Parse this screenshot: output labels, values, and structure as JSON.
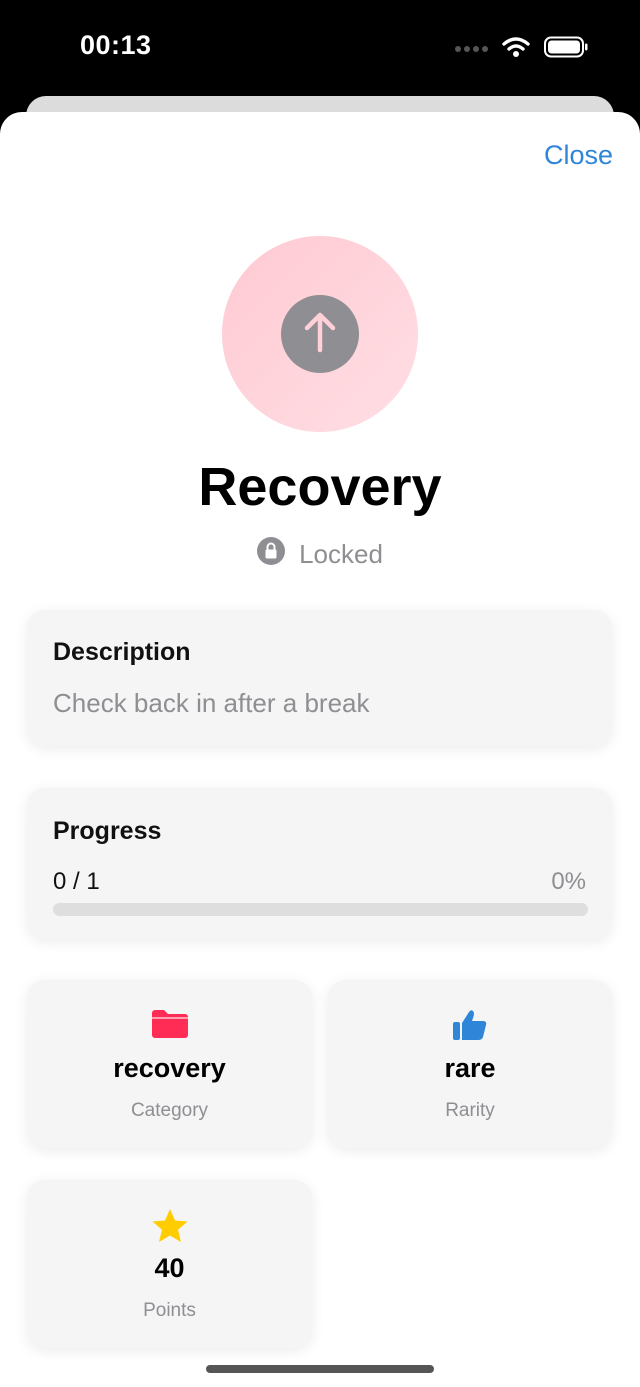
{
  "status_bar": {
    "time": "00:13"
  },
  "sheet": {
    "close_label": "Close",
    "achievement": {
      "title": "Recovery",
      "state": "Locked",
      "icon": "arrow-up-icon",
      "badge_colors": {
        "gradient_start": "#ffc9d2",
        "gradient_end": "#ffdfe4",
        "inner": "#8e8e93"
      }
    },
    "description": {
      "heading": "Description",
      "text": "Check back in after a break"
    },
    "progress": {
      "heading": "Progress",
      "count": "0 / 1",
      "percent_label": "0%",
      "value": 0
    },
    "stats": {
      "category": {
        "value": "recovery",
        "label": "Category",
        "icon": "folder-icon",
        "color": "#ff2d55"
      },
      "rarity": {
        "value": "rare",
        "label": "Rarity",
        "icon": "thumbs-up-icon",
        "color": "#2f86d8"
      },
      "points": {
        "value": "40",
        "label": "Points",
        "icon": "star-icon",
        "color": "#ffcc00"
      }
    }
  },
  "colors": {
    "accent": "#2f86d8",
    "secondary_text": "#8e8e93"
  }
}
